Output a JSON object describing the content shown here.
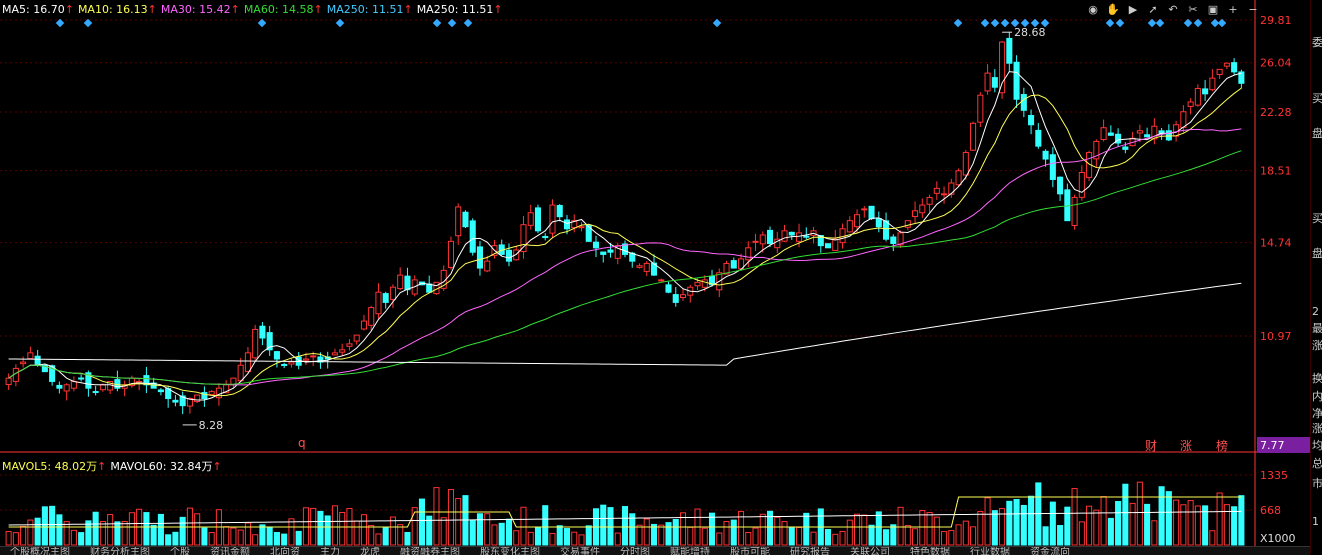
{
  "ma_legend": [
    {
      "label": "MA5: 16.70",
      "arrow": "↑",
      "color": "#ffffff"
    },
    {
      "label": "MA10: 16.13",
      "arrow": "↑",
      "color": "#ffff55"
    },
    {
      "label": "MA30: 15.42",
      "arrow": "↑",
      "color": "#ff66ff"
    },
    {
      "label": "MA60: 14.58",
      "arrow": "↑",
      "color": "#33dd33"
    },
    {
      "label": "MA250: 11.51",
      "arrow": "↑",
      "color": "#44ccff"
    },
    {
      "label": "MA250: 11.51",
      "arrow": "↑",
      "color": "#ffffff"
    }
  ],
  "vol_legend": [
    {
      "label": "MAVOL5: 48.02万",
      "arrow": "↑",
      "color": "#ffff55"
    },
    {
      "label": "MAVOL60: 32.84万",
      "arrow": "↑",
      "color": "#ffffff"
    }
  ],
  "colors": {
    "up": "#ff3333",
    "down": "#33ffff",
    "grid": "#5a0000",
    "axis": "#ff3333"
  },
  "toolbar": [
    "eye-icon",
    "hand-icon",
    "play-icon",
    "pointer-icon",
    "undo-icon",
    "scissors-icon",
    "lock-icon",
    "plus-icon",
    "minus-icon"
  ],
  "price_axis": {
    "ticks": [
      "29.81",
      "26.04",
      "22.28",
      "18.51",
      "14.74",
      "10.97",
      "7.77"
    ]
  },
  "volume_axis": {
    "ticks": [
      "1335",
      "668"
    ],
    "unit": "X1000"
  },
  "annotations": {
    "high": "28.68",
    "low": "8.28",
    "q_mark": "q",
    "events": [
      "财",
      "涨",
      "榜"
    ]
  },
  "right_panel": [
    "委",
    "买",
    "盘",
    "买",
    "盘",
    "2",
    "最",
    "涨",
    "换",
    "内",
    "净",
    "涨",
    "均",
    "总",
    "市",
    "1"
  ],
  "tabs": [
    "个股概况主图",
    "财务分析主图",
    "个股",
    "资讯金额",
    "北向资",
    "主力",
    "龙虎",
    "融资融券主图",
    "股东变化主图",
    "交易事件",
    "分时图",
    "赋能增持",
    "股市可能",
    "研究报告",
    "关联公司",
    "特色数据",
    "行业数据",
    "资金流向"
  ],
  "chart_data": {
    "type": "candlestick",
    "ylim": [
      7.77,
      29.81
    ],
    "y_log": true,
    "high_point": 28.68,
    "low_point": 8.28,
    "closes": [
      9.6,
      9.9,
      10.1,
      10.4,
      10.0,
      9.8,
      9.5,
      9.3,
      9.4,
      9.5,
      9.6,
      9.3,
      9.2,
      9.4,
      9.5,
      9.3,
      9.4,
      9.6,
      9.5,
      9.4,
      9.3,
      9.2,
      9.0,
      8.9,
      8.8,
      9.0,
      9.1,
      9.0,
      9.2,
      9.3,
      9.4,
      9.6,
      10.0,
      10.4,
      11.2,
      10.9,
      10.5,
      10.2,
      10.0,
      10.1,
      10.0,
      10.2,
      10.3,
      10.1,
      10.2,
      10.4,
      10.5,
      10.7,
      11.0,
      11.5,
      12.0,
      12.6,
      12.2,
      12.8,
      13.3,
      12.7,
      13.1,
      12.9,
      12.6,
      13.0,
      13.5,
      14.8,
      16.5,
      15.5,
      14.3,
      13.6,
      13.9,
      14.6,
      14.2,
      13.9,
      14.4,
      15.6,
      16.2,
      15.3,
      15.0,
      16.6,
      16.0,
      15.4,
      15.8,
      15.5,
      14.8,
      14.5,
      14.2,
      14.3,
      14.6,
      14.2,
      13.9,
      13.7,
      13.8,
      13.3,
      13.1,
      12.6,
      12.2,
      12.5,
      12.8,
      13.0,
      13.1,
      12.9,
      13.4,
      13.8,
      13.6,
      14.0,
      14.5,
      14.8,
      15.1,
      14.7,
      14.9,
      15.3,
      15.1,
      15.2,
      15.0,
      15.3,
      14.6,
      14.5,
      14.9,
      15.4,
      15.8,
      16.1,
      16.4,
      15.9,
      15.5,
      14.9,
      14.7,
      15.2,
      15.8,
      16.3,
      16.6,
      17.0,
      17.5,
      17.2,
      17.8,
      18.5,
      19.6,
      21.5,
      23.5,
      25.2,
      24.1,
      27.8,
      26.0,
      23.2,
      22.4,
      21.4,
      20.0,
      19.2,
      18.0,
      17.2,
      15.8,
      17.0,
      18.4,
      19.6,
      20.3,
      21.2,
      20.7,
      20.2,
      19.8,
      20.5,
      21.0,
      20.6,
      21.3,
      20.8,
      20.4,
      21.4,
      22.3,
      23.0,
      24.0,
      23.6,
      24.8,
      25.5,
      26.0,
      25.3,
      24.4
    ]
  }
}
